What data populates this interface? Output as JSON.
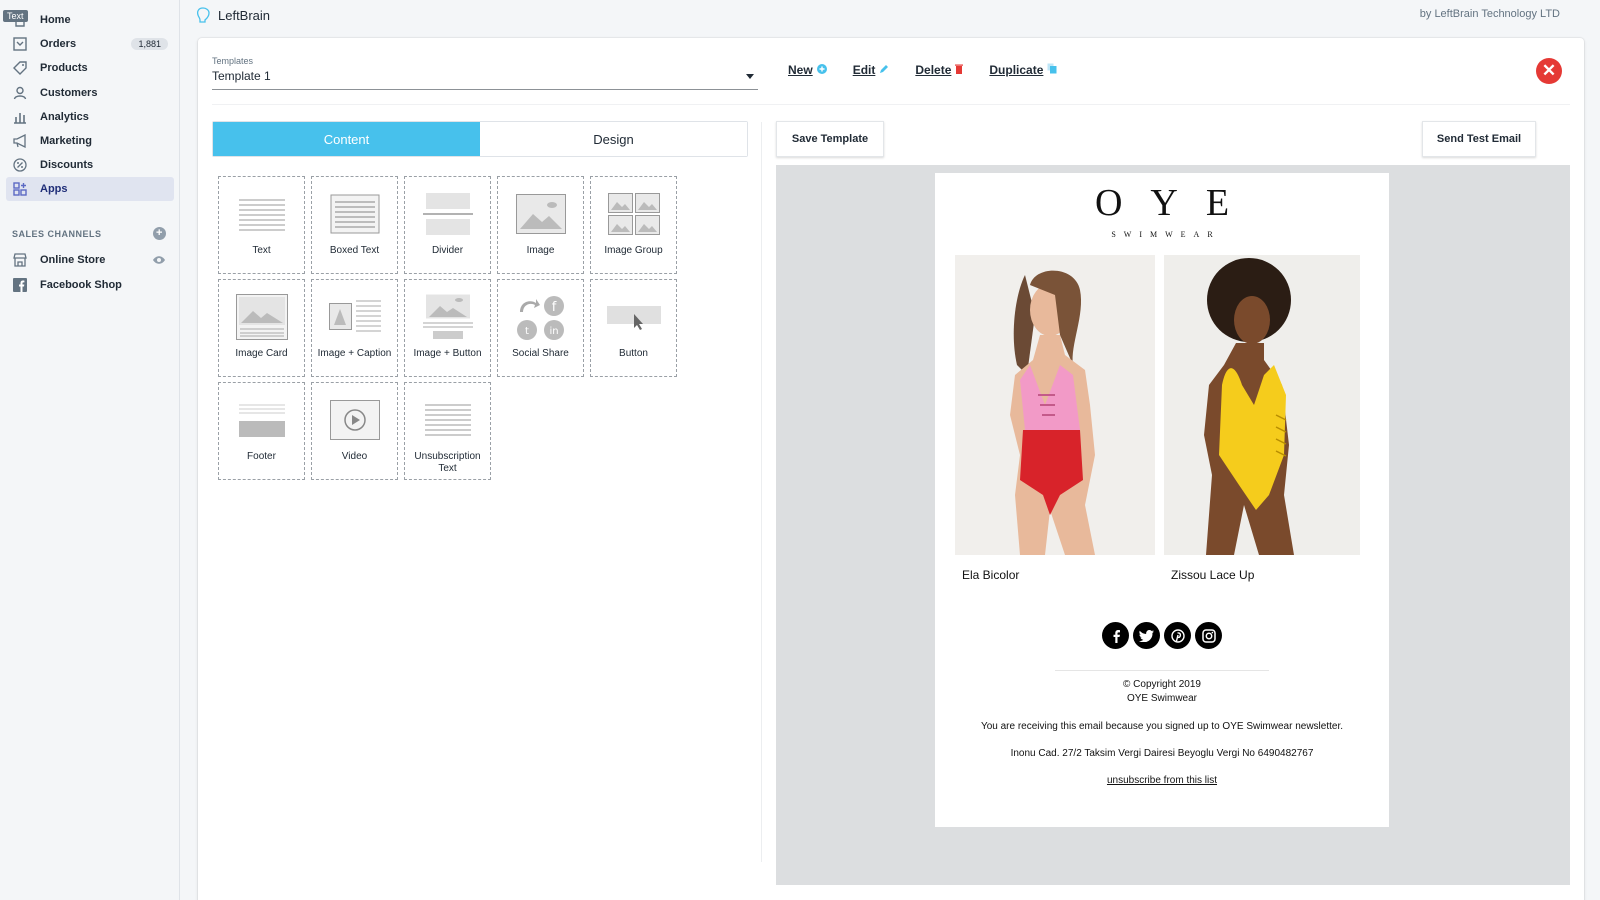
{
  "sidebar": {
    "text_chip": "Text",
    "items": [
      {
        "label": "Home",
        "icon": "home-icon"
      },
      {
        "label": "Orders",
        "icon": "orders-icon",
        "badge": "1,881"
      },
      {
        "label": "Products",
        "icon": "tag-icon"
      },
      {
        "label": "Customers",
        "icon": "person-icon"
      },
      {
        "label": "Analytics",
        "icon": "bar-chart-icon"
      },
      {
        "label": "Marketing",
        "icon": "megaphone-icon"
      },
      {
        "label": "Discounts",
        "icon": "discount-icon"
      },
      {
        "label": "Apps",
        "icon": "apps-icon",
        "active": true
      }
    ],
    "sales_channels_title": "SALES CHANNELS",
    "channels": [
      {
        "label": "Online Store",
        "icon": "store-icon"
      },
      {
        "label": "Facebook Shop",
        "icon": "facebook-icon"
      }
    ]
  },
  "topbar": {
    "app_name": "LeftBrain",
    "byline": "by LeftBrain Technology LTD"
  },
  "editor": {
    "template_label": "Templates",
    "template_value": "Template 1",
    "actions": {
      "new": "New",
      "edit": "Edit",
      "delete": "Delete",
      "duplicate": "Duplicate"
    },
    "tabs": {
      "content": "Content",
      "design": "Design"
    },
    "blocks": [
      "Text",
      "Boxed Text",
      "Divider",
      "Image",
      "Image Group",
      "Image Card",
      "Image + Caption",
      "Image + Button",
      "Social Share",
      "Button",
      "Footer",
      "Video",
      "Unsubscription Text"
    ],
    "save_template": "Save Template",
    "send_test_email": "Send Test Email"
  },
  "email_preview": {
    "brand": "OYE",
    "brand_sub": "SWIMWEAR",
    "products": [
      {
        "name": "Ela Bicolor"
      },
      {
        "name": "Zissou Lace Up"
      }
    ],
    "socials": [
      "facebook-icon",
      "twitter-icon",
      "pinterest-icon",
      "instagram-icon"
    ],
    "copyright": "© Copyright 2019",
    "company": "OYE Swimwear",
    "reason": "You are receiving this email because you signed up to OYE Swimwear newsletter.",
    "address": "Inonu Cad. 27/2 Taksim Vergi Dairesi Beyoglu Vergi No 6490482767",
    "unsubscribe": "unsubscribe from this list"
  },
  "colors": {
    "accent": "#47c1ec",
    "close": "#e53935",
    "active_nav": "#e0e4f0"
  }
}
